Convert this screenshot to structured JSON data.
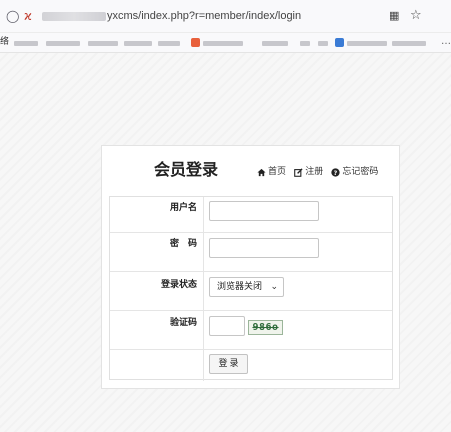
{
  "browser": {
    "url_visible": "yxcms/index.php?r=member/index/login",
    "bookmarks_first_label": "络"
  },
  "login": {
    "title": "会员登录",
    "links": [
      {
        "label": "首页",
        "icon": "home-icon"
      },
      {
        "label": "注册",
        "icon": "edit-icon"
      },
      {
        "label": "忘记密码",
        "icon": "question-circle-icon"
      }
    ],
    "fields": {
      "username_label": "用户名",
      "username_value": "",
      "password_label": "密　码",
      "password_value": "",
      "status_label": "登录状态",
      "status_selected": "浏览器关闭",
      "captcha_label": "验证码",
      "captcha_value": "",
      "captcha_image_text": "986o"
    },
    "submit_label": "登录"
  }
}
